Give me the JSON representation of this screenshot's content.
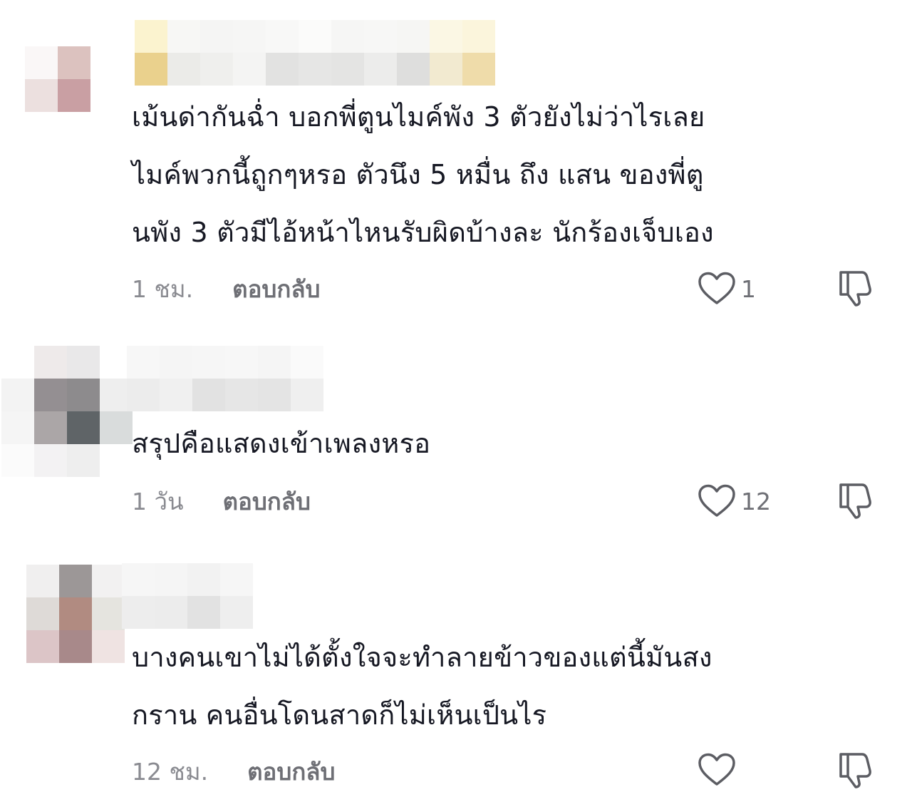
{
  "comments": [
    {
      "text": "เม้นด่ากันฉ่ำ บอกพี่ตูนไมค์พัง 3 ตัวยังไม่ว่าไรเลย\nไมค์พวกนี้ถูกๆหรอ ตัวนึง 5 หมื่น ถึง แสน ของพี่ตู\nนพัง 3 ตัวมีไอ้หน้าไหนรับผิดบ้างละ นักร้องเจ็บเอง",
      "time": "1 ชม.",
      "reply_label": "ตอบกลับ",
      "like_count": "1"
    },
    {
      "text": "สรุปคือแสดงเข้าเพลงหรอ",
      "time": "1 วัน",
      "reply_label": "ตอบกลับ",
      "like_count": "12"
    },
    {
      "text": "บางคนเขาไม่ได้ตั้งใจจะทำลายข้าวของแต่นี้มันสง\nกราน คนอื่นโดนสาดก็ไม่เห็นเป็นไร",
      "time": "12 ชม.",
      "reply_label": "ตอบกลับ",
      "like_count": ""
    }
  ],
  "icons": {
    "like": "heart-outline-icon",
    "dislike": "thumbs-down-outline-icon"
  },
  "colors": {
    "text": "#161823",
    "meta": "#8a8b91",
    "icon": "#5c5d63"
  }
}
